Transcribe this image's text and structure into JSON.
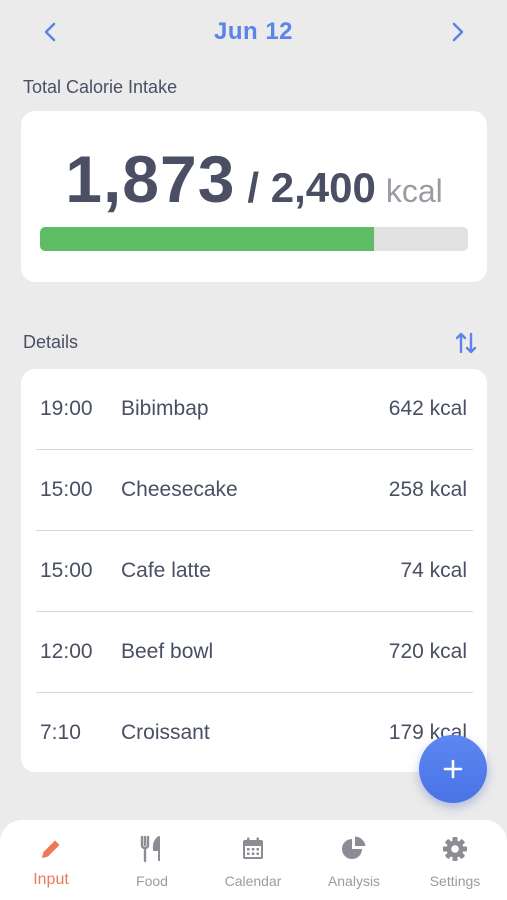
{
  "header": {
    "date": "Jun 12",
    "prev_icon": "chevron-left-icon",
    "next_icon": "chevron-right-icon"
  },
  "total": {
    "label": "Total Calorie Intake",
    "intake": "1,873",
    "goal_text": "/ 2,400",
    "unit": "kcal",
    "progress_fraction": 0.78,
    "progress_color": "#5ebd64"
  },
  "details": {
    "label": "Details",
    "sort_icon": "sort-arrows-icon",
    "entries": [
      {
        "time": "19:00",
        "food": "Bibimbap",
        "kcal": "642 kcal"
      },
      {
        "time": "15:00",
        "food": "Cheesecake",
        "kcal": "258 kcal"
      },
      {
        "time": "15:00",
        "food": "Cafe latte",
        "kcal": "74 kcal"
      },
      {
        "time": "12:00",
        "food": "Beef bowl",
        "kcal": "720 kcal"
      },
      {
        "time": "7:10",
        "food": "Croissant",
        "kcal": "179 kcal"
      }
    ]
  },
  "fab": {
    "icon": "plus-icon",
    "color": "#5a84ee"
  },
  "tabs": [
    {
      "label": "Input",
      "icon": "pencil-icon",
      "active": true
    },
    {
      "label": "Food",
      "icon": "fork-knife-icon",
      "active": false
    },
    {
      "label": "Calendar",
      "icon": "calendar-icon",
      "active": false
    },
    {
      "label": "Analysis",
      "icon": "pie-chart-icon",
      "active": false
    },
    {
      "label": "Settings",
      "icon": "gear-icon",
      "active": false
    }
  ],
  "colors": {
    "accent": "#5b84e8",
    "active_tab": "#ec7a59",
    "text": "#4a4f63",
    "muted": "#9a9ba3"
  }
}
